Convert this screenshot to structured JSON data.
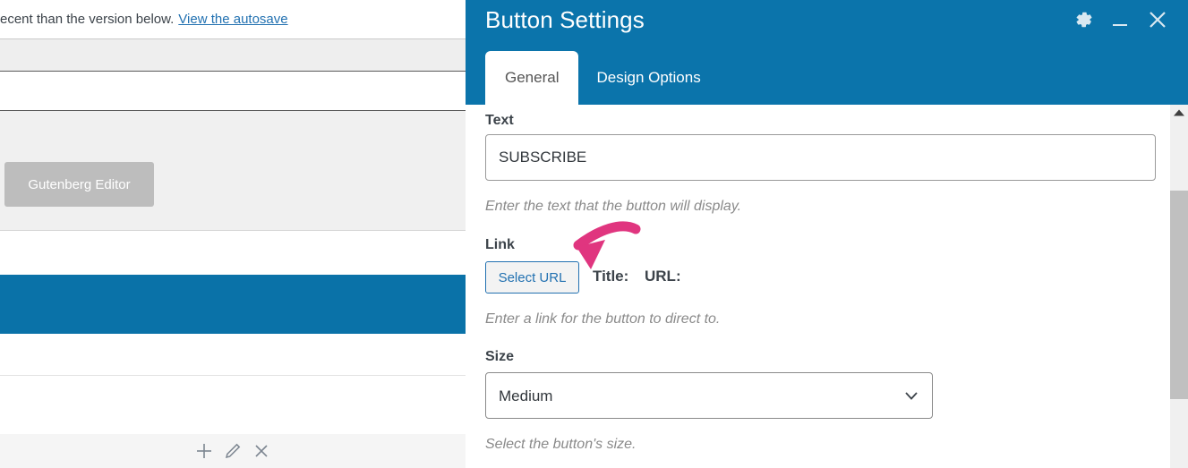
{
  "editor_background": {
    "notice": {
      "text": "recent than the version below.",
      "link_label": "View the autosave"
    },
    "gutenberg_button_label": "Gutenberg Editor",
    "block_actions": [
      {
        "name": "add-block-icon",
        "label": "+"
      },
      {
        "name": "edit-block-icon",
        "label": "edit"
      },
      {
        "name": "delete-block-icon",
        "label": "x"
      }
    ],
    "colors": {
      "blue_band": "#0a72a8",
      "gray_band": "#f0f0f0",
      "button_gray": "#bdbdbd",
      "link_blue": "#2271b1"
    }
  },
  "modal": {
    "title": "Button Settings",
    "header_color": "#0b74ab",
    "window_controls": [
      {
        "name": "settings-gear-icon",
        "label": "Settings"
      },
      {
        "name": "minimize-icon",
        "label": "Minimize"
      },
      {
        "name": "close-icon",
        "label": "Close"
      }
    ],
    "tabs": [
      {
        "label": "General",
        "active": true
      },
      {
        "label": "Design Options",
        "active": false
      }
    ],
    "fields": {
      "text": {
        "label": "Text",
        "value": "SUBSCRIBE",
        "placeholder": "",
        "help": "Enter the text that the button will display."
      },
      "link": {
        "label": "Link",
        "button_label": "Select URL",
        "title_label": "Title:",
        "title_value": "",
        "url_label": "URL:",
        "url_value": "",
        "help": "Enter a link for the button to direct to."
      },
      "size": {
        "label": "Size",
        "value": "Medium",
        "options": [
          "Medium"
        ],
        "help": "Select the button's size."
      }
    },
    "annotation": {
      "type": "arrow",
      "color": "#e0357f",
      "points_to": "Select URL"
    },
    "scrollbar": {
      "up_arrow": "scroll-up-icon",
      "thumb_color": "#c0c0c0"
    }
  }
}
